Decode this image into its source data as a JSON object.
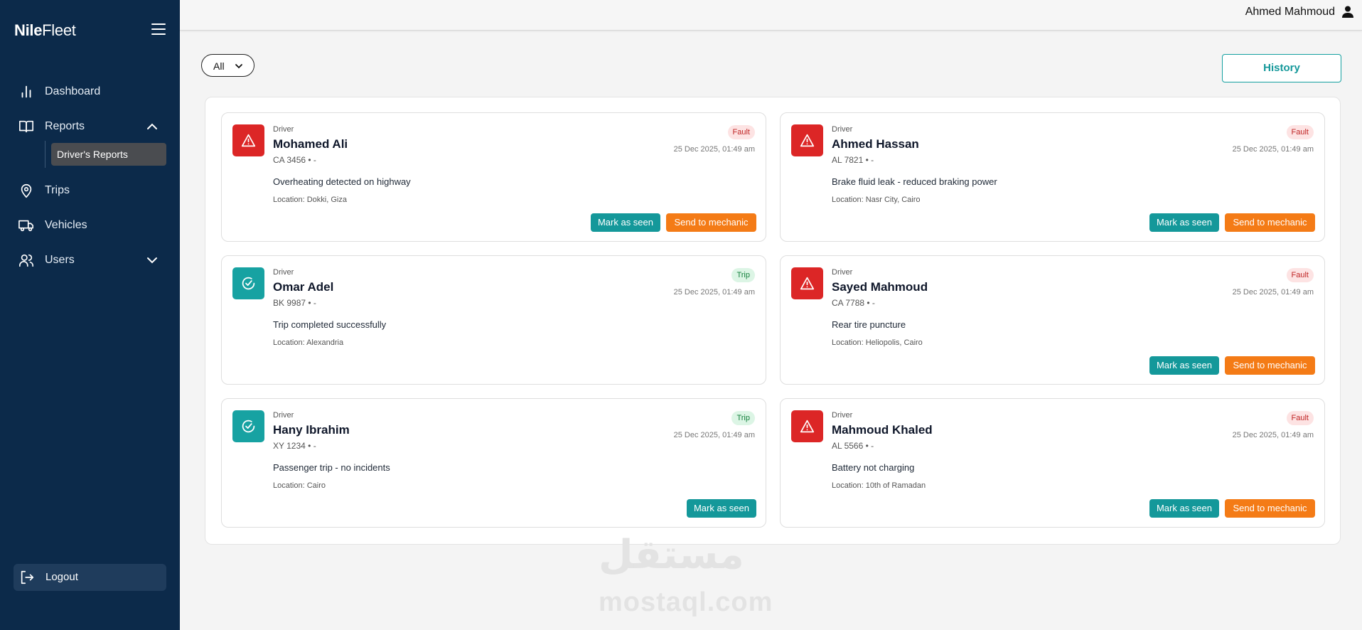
{
  "brand": {
    "bold": "Nile",
    "light": "Fleet"
  },
  "sidebar": {
    "items": [
      {
        "label": "Dashboard",
        "icon": "bar-chart-icon"
      },
      {
        "label": "Reports",
        "icon": "book-icon",
        "expanded": true,
        "subitems": [
          {
            "label": "Driver's Reports",
            "active": true
          }
        ]
      },
      {
        "label": "Trips",
        "icon": "map-pin-icon"
      },
      {
        "label": "Vehicles",
        "icon": "truck-icon"
      },
      {
        "label": "Users",
        "icon": "users-icon",
        "expanded": false
      }
    ],
    "logout_label": "Logout"
  },
  "topbar": {
    "user_name": "Ahmed Mahmoud"
  },
  "filter": {
    "value": "All"
  },
  "history_label": "History",
  "colors": {
    "sidebar": "#0c2a4a",
    "teal": "#14989a",
    "orange": "#f47b16",
    "fault_red": "#dc2626"
  },
  "reports": [
    {
      "role": "Driver",
      "name": "Mohamed Ali",
      "plate": "CA 3456 • -",
      "tag": "Fault",
      "type": "fault",
      "date": "25 Dec 2025, 01:49 am",
      "description": "Overheating detected on highway",
      "location": "Location: Dokki, Giza",
      "actions": [
        "Mark as seen",
        "Send to mechanic"
      ]
    },
    {
      "role": "Driver",
      "name": "Ahmed Hassan",
      "plate": "AL 7821 • -",
      "tag": "Fault",
      "type": "fault",
      "date": "25 Dec 2025, 01:49 am",
      "description": "Brake fluid leak - reduced braking power",
      "location": "Location: Nasr City, Cairo",
      "actions": [
        "Mark as seen",
        "Send to mechanic"
      ]
    },
    {
      "role": "Driver",
      "name": "Omar Adel",
      "plate": "BK 9987 • -",
      "tag": "Trip",
      "type": "trip",
      "date": "25 Dec 2025, 01:49 am",
      "description": "Trip completed successfully",
      "location": "Location: Alexandria",
      "actions": []
    },
    {
      "role": "Driver",
      "name": "Sayed Mahmoud",
      "plate": "CA 7788 • -",
      "tag": "Fault",
      "type": "fault",
      "date": "25 Dec 2025, 01:49 am",
      "description": "Rear tire puncture",
      "location": "Location: Heliopolis, Cairo",
      "actions": [
        "Mark as seen",
        "Send to mechanic"
      ]
    },
    {
      "role": "Driver",
      "name": "Hany Ibrahim",
      "plate": "XY 1234 • -",
      "tag": "Trip",
      "type": "trip",
      "date": "25 Dec 2025, 01:49 am",
      "description": "Passenger trip - no incidents",
      "location": "Location: Cairo",
      "actions": [
        "Mark as seen"
      ]
    },
    {
      "role": "Driver",
      "name": "Mahmoud Khaled",
      "plate": "AL 5566 • -",
      "tag": "Fault",
      "type": "fault",
      "date": "25 Dec 2025, 01:49 am",
      "description": "Battery not charging",
      "location": "Location: 10th of Ramadan",
      "actions": [
        "Mark as seen",
        "Send to mechanic"
      ]
    }
  ],
  "watermark": {
    "arabic": "مستقل",
    "latin": "mostaql.com"
  }
}
